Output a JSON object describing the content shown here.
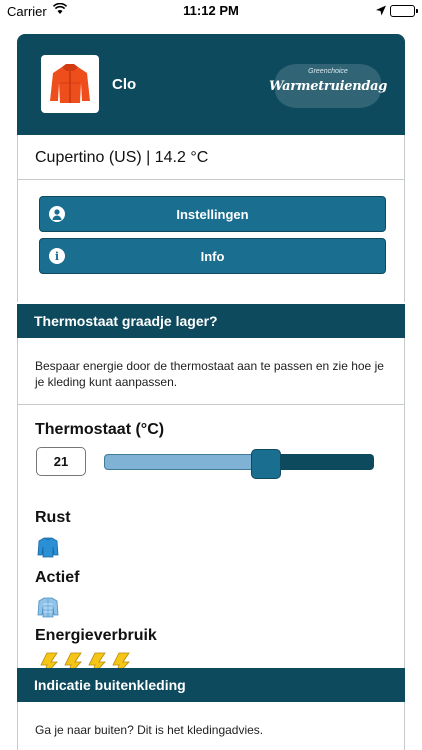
{
  "statusbar": {
    "carrier": "Carrier",
    "time": "11:12 PM"
  },
  "header": {
    "username": "Clo",
    "logo_small": "Greenchoice",
    "logo_big": "Warmetruiendag"
  },
  "location": {
    "text": "Cupertino (US) | 14.2 °C"
  },
  "buttons": {
    "settings": "Instellingen",
    "info": "Info",
    "info_icon": "i"
  },
  "thermo_section": {
    "title": "Thermostaat graadje lager?",
    "description": "Bespaar energie door de thermostaat aan te passen en zie hoe je je kleding kunt aanpassen.",
    "thermostat_label": "Thermostaat (°C)",
    "thermostat_value": "21",
    "slider_fraction": 0.6,
    "rest_label": "Rust",
    "active_label": "Actief",
    "energy_label": "Energieverbruik",
    "energy_level": 4
  },
  "outdoor_section": {
    "title": "Indicatie buitenkleding",
    "description": "Ga je naar buiten? Dit is het kledingadvies."
  },
  "colors": {
    "primary": "#0e4a5e",
    "button": "#1a6f91",
    "slider_fill": "#7fb2d4",
    "energy": "#f5c518"
  }
}
